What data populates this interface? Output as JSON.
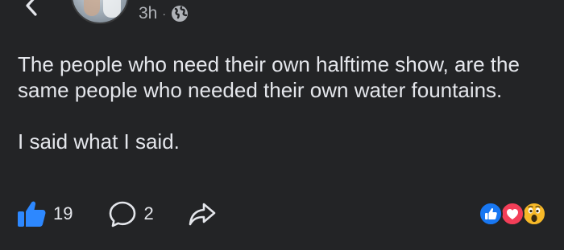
{
  "header": {
    "timestamp": "3h",
    "separator": "·",
    "privacy_icon": "globe-icon",
    "back_icon": "chevron-left-icon",
    "more_icon": "more-dots-icon"
  },
  "post": {
    "paragraph_1": "The people who need their own halftime show, are the same people who needed their own water fountains.",
    "paragraph_2": "I said what I said."
  },
  "actions": {
    "like_count": "19",
    "comment_count": "2",
    "like_icon": "thumbs-up-icon",
    "comment_icon": "comment-bubble-icon",
    "share_icon": "share-arrow-icon"
  },
  "reactions": [
    "like",
    "love",
    "wow"
  ],
  "colors": {
    "background": "#232426",
    "text": "#e4e6eb",
    "secondary_text": "#b0b3b8",
    "like_blue": "#1877f2",
    "love_red": "#f33e58",
    "wow_yellow": "#f7b928"
  }
}
